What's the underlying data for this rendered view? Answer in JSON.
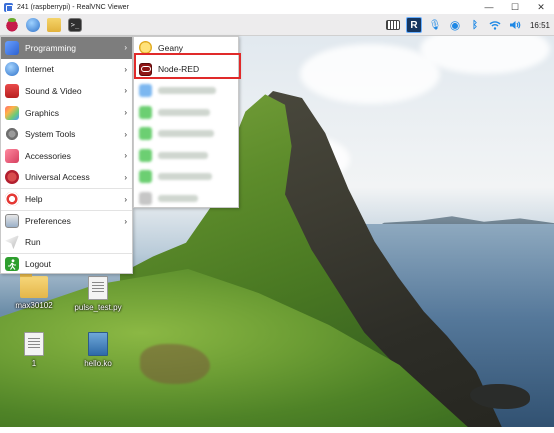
{
  "window": {
    "title": "241 (raspberrypi) - RealVNC Viewer",
    "controls": [
      "—",
      "☐",
      "✕"
    ]
  },
  "taskbar": {
    "launchers": [
      {
        "name": "raspberry-menu",
        "icon": "raspberry-icon"
      },
      {
        "name": "web-browser",
        "icon": "globe-icon"
      },
      {
        "name": "file-manager",
        "icon": "folder-icon"
      },
      {
        "name": "terminal",
        "icon": "terminal-icon",
        "glyph": ">_"
      }
    ],
    "tray": {
      "vnc_glyph": "R",
      "mic_glyph": "🎙",
      "bluetooth_glyph": "ᛒ",
      "time": "16:51"
    }
  },
  "menu": {
    "items": [
      {
        "label": "Programming",
        "has_submenu": true
      },
      {
        "label": "Internet",
        "has_submenu": true
      },
      {
        "label": "Sound & Video",
        "has_submenu": true
      },
      {
        "label": "Graphics",
        "has_submenu": true
      },
      {
        "label": "System Tools",
        "has_submenu": true
      },
      {
        "label": "Accessories",
        "has_submenu": true
      },
      {
        "label": "Universal Access",
        "has_submenu": true
      },
      {
        "label": "Help",
        "has_submenu": true
      },
      {
        "label": "Preferences",
        "has_submenu": true
      },
      {
        "label": "Run",
        "has_submenu": false
      },
      {
        "label": "Logout",
        "has_submenu": false
      }
    ],
    "arrow": "›"
  },
  "submenu": {
    "items": [
      {
        "label": "Geany"
      },
      {
        "label": "Node-RED"
      }
    ]
  },
  "desktop": {
    "icons": [
      {
        "label": "max30102"
      },
      {
        "label": "pulse_test.py"
      },
      {
        "label": "1"
      },
      {
        "label": "hello.ko"
      }
    ]
  },
  "colors": {
    "highlight": "#e02a2a",
    "active_menu_bg": "#7d7d7d"
  }
}
